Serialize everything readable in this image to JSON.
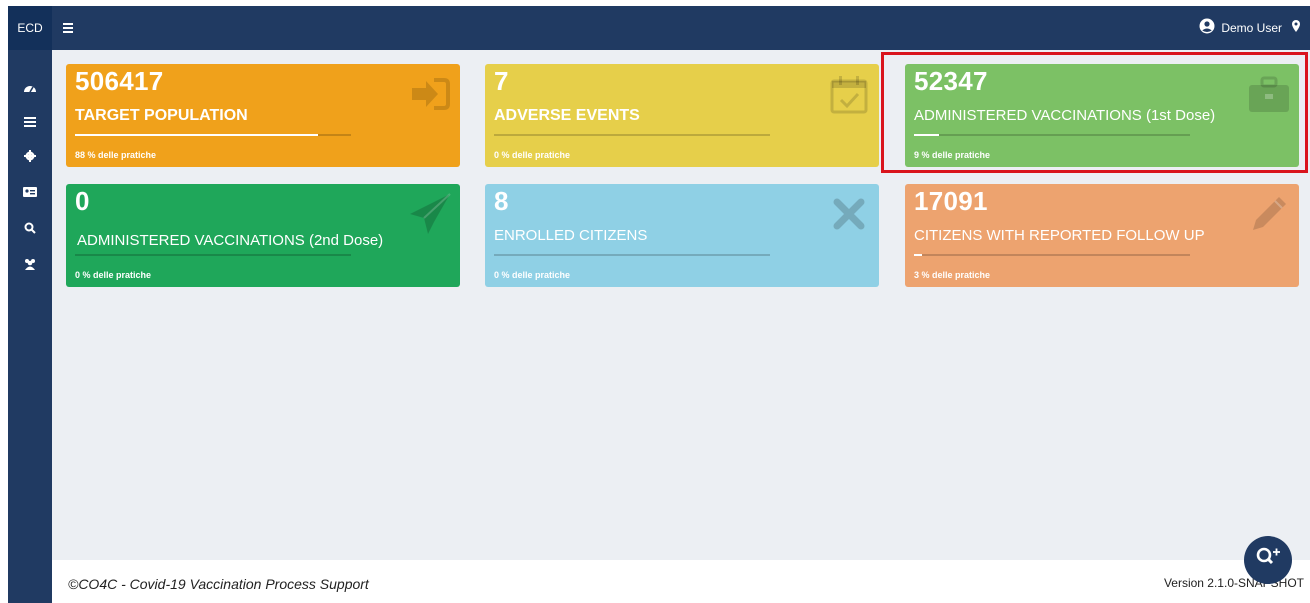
{
  "app": {
    "brand": "ECD"
  },
  "header": {
    "user_name": "Demo User"
  },
  "cards": [
    {
      "value": "506417",
      "label": "TARGET POPULATION",
      "progress_percent": 88,
      "pct_text": "88 % delle pratiche",
      "color": "#f0a11b",
      "icon": "sign-in-icon"
    },
    {
      "value": "7",
      "label": "ADVERSE EVENTS",
      "progress_percent": 0,
      "pct_text": "0 % delle pratiche",
      "color": "#e6cf4a",
      "icon": "calendar-check-icon"
    },
    {
      "value": "52347",
      "label": "ADMINISTERED VACCINATIONS (1st Dose)",
      "progress_percent": 9,
      "pct_text": "9 % delle pratiche",
      "color": "#7cc165",
      "icon": "briefcase-icon"
    },
    {
      "value": "0",
      "label": "ADMINISTERED VACCINATIONS (2nd Dose)",
      "progress_percent": 0,
      "pct_text": "0 % delle pratiche",
      "color": "#1fa75a",
      "icon": "paper-plane-icon"
    },
    {
      "value": "8",
      "label": "ENROLLED CITIZENS",
      "progress_percent": 0,
      "pct_text": "0 % delle pratiche",
      "color": "#8fd0e5",
      "icon": "times-icon"
    },
    {
      "value": "17091",
      "label": "CITIZENS WITH REPORTED FOLLOW UP",
      "progress_percent": 3,
      "pct_text": "3 % delle pratiche",
      "color": "#eda36f",
      "icon": "pencil-icon"
    }
  ],
  "sidebar": {
    "items": [
      {
        "icon": "dashboard-icon"
      },
      {
        "icon": "list-icon"
      },
      {
        "icon": "gear-icon"
      },
      {
        "icon": "id-card-icon"
      },
      {
        "icon": "search-icon"
      },
      {
        "icon": "users-icon"
      }
    ]
  },
  "footer": {
    "copyright": "©CO4C - Covid-19 Vaccination Process Support",
    "version": "Version 2.1.0-SNAPSHOT"
  },
  "fab": {
    "icon": "search-plus-icon"
  }
}
